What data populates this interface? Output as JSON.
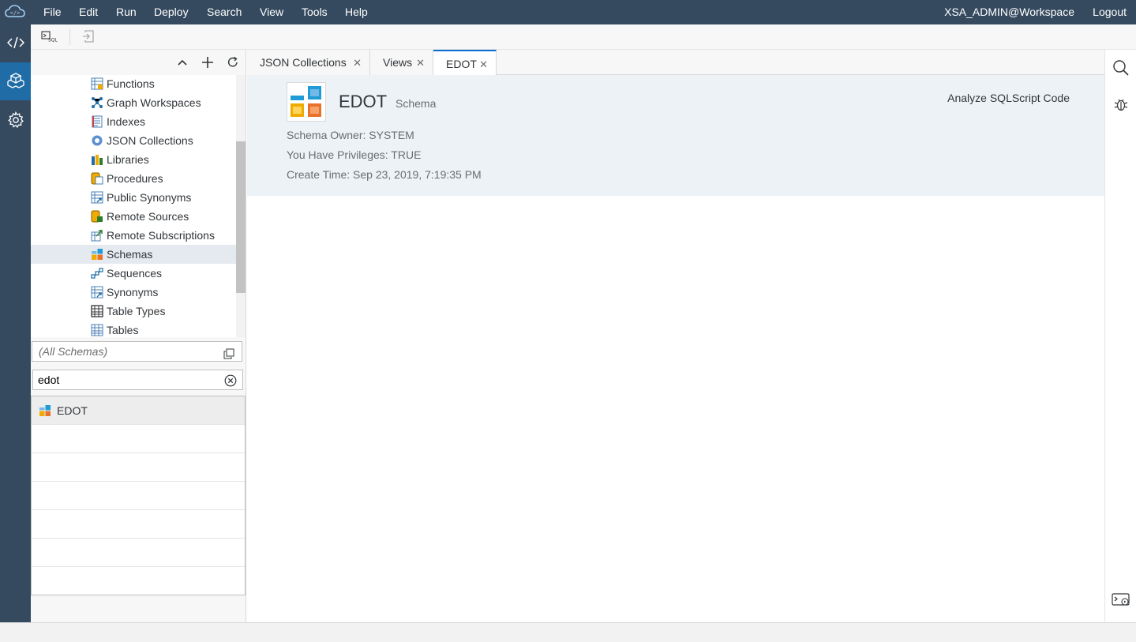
{
  "menubar": {
    "items": [
      "File",
      "Edit",
      "Run",
      "Deploy",
      "Search",
      "View",
      "Tools",
      "Help"
    ],
    "user": "XSA_ADMIN@Workspace",
    "logout": "Logout"
  },
  "rail": {
    "items": [
      {
        "icon": "code-icon"
      },
      {
        "icon": "database-explorer-icon",
        "active": true
      },
      {
        "icon": "settings-gear-icon"
      }
    ]
  },
  "toolbar": {
    "sql_console_icon": "sql-console-icon",
    "import_icon": "import-icon"
  },
  "tree": {
    "items": [
      {
        "label": "Functions",
        "icon": "functions-icon"
      },
      {
        "label": "Graph Workspaces",
        "icon": "graph-workspace-icon"
      },
      {
        "label": "Indexes",
        "icon": "index-icon"
      },
      {
        "label": "JSON Collections",
        "icon": "json-collection-icon"
      },
      {
        "label": "Libraries",
        "icon": "library-icon"
      },
      {
        "label": "Procedures",
        "icon": "procedure-icon"
      },
      {
        "label": "Public Synonyms",
        "icon": "public-synonym-icon"
      },
      {
        "label": "Remote Sources",
        "icon": "remote-source-icon"
      },
      {
        "label": "Remote Subscriptions",
        "icon": "remote-subscription-icon"
      },
      {
        "label": "Schemas",
        "icon": "schema-icon",
        "selected": true
      },
      {
        "label": "Sequences",
        "icon": "sequence-icon"
      },
      {
        "label": "Synonyms",
        "icon": "synonym-icon"
      },
      {
        "label": "Table Types",
        "icon": "table-type-icon"
      },
      {
        "label": "Tables",
        "icon": "table-icon"
      }
    ]
  },
  "filter": {
    "schema_placeholder": "(All Schemas)",
    "search_value": "edot"
  },
  "results": {
    "rows": [
      {
        "label": "EDOT",
        "icon": "schema-icon",
        "selected": true
      }
    ]
  },
  "tabs": [
    {
      "label": "JSON Collections"
    },
    {
      "label": "Views"
    },
    {
      "label": "EDOT",
      "active": true
    }
  ],
  "object": {
    "name": "EDOT",
    "type": "Schema",
    "analyze_label": "Analyze SQLScript Code",
    "attributes": [
      "Schema Owner: SYSTEM",
      "You Have Privileges: TRUE",
      "Create Time: Sep 23, 2019, 7:19:35 PM"
    ]
  },
  "right_rail": {
    "icons": [
      "search-icon",
      "debugger-bug-icon",
      "console-icon"
    ]
  },
  "colors": {
    "shell": "#354a5f",
    "accent": "#0a6ed1",
    "header_bg": "#edf2f7"
  }
}
